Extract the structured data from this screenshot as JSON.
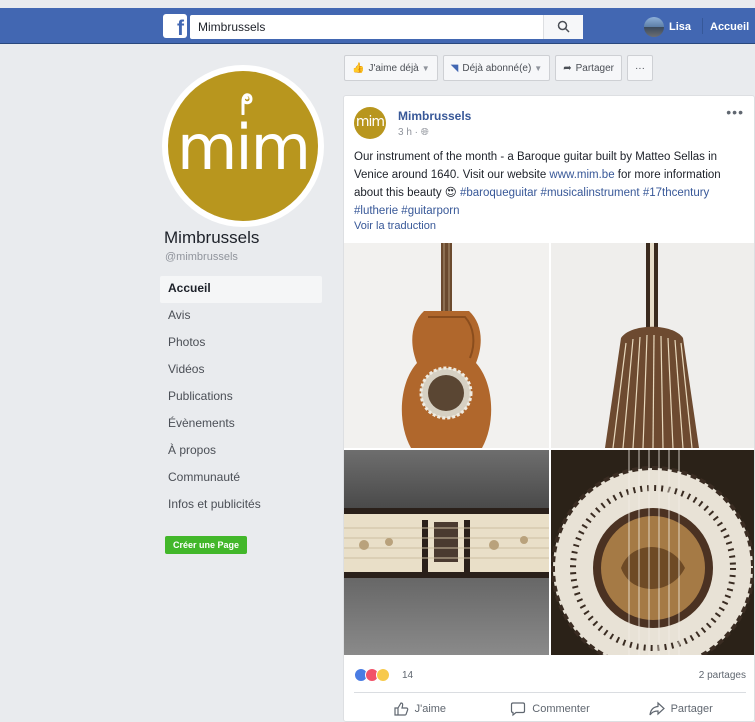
{
  "topbar": {
    "logo": "f",
    "search_value": "Mimbrussels",
    "user_name": "Lisa",
    "home_label": "Accueil"
  },
  "page": {
    "logo_text": "mim",
    "name": "Mimbrussels",
    "handle": "@mimbrussels"
  },
  "nav": {
    "items": [
      {
        "label": "Accueil",
        "active": true
      },
      {
        "label": "Avis"
      },
      {
        "label": "Photos"
      },
      {
        "label": "Vidéos"
      },
      {
        "label": "Publications"
      },
      {
        "label": "Évènements"
      },
      {
        "label": "À propos"
      },
      {
        "label": "Communauté"
      },
      {
        "label": "Infos et publicités"
      }
    ],
    "create_page": "Créer une Page"
  },
  "actions": {
    "like": "J'aime déjà",
    "follow": "Déjà abonné(e)",
    "share": "Partager",
    "more": "···"
  },
  "post": {
    "avatar_text": "mim",
    "author": "Mimbrussels",
    "time": "3 h ·",
    "text_1": "Our instrument of the month - a Baroque guitar built by Matteo Sellas in Venice around 1640. Visit our website ",
    "link": "www.mim.be",
    "text_2": " for more information about this beauty ",
    "emoji": "😍",
    "hashtags": "#baroqueguitar #musicalinstrument #17thcentury #lutherie #guitarporn",
    "translate": "Voir la traduction",
    "reactions_count": "14",
    "shares": "2 partages",
    "like_btn": "J'aime",
    "comment_btn": "Commenter",
    "share_btn": "Partager"
  },
  "colors": {
    "fb_blue": "#4267b2",
    "mim_gold": "#b8961e",
    "create_green": "#42b72a"
  }
}
